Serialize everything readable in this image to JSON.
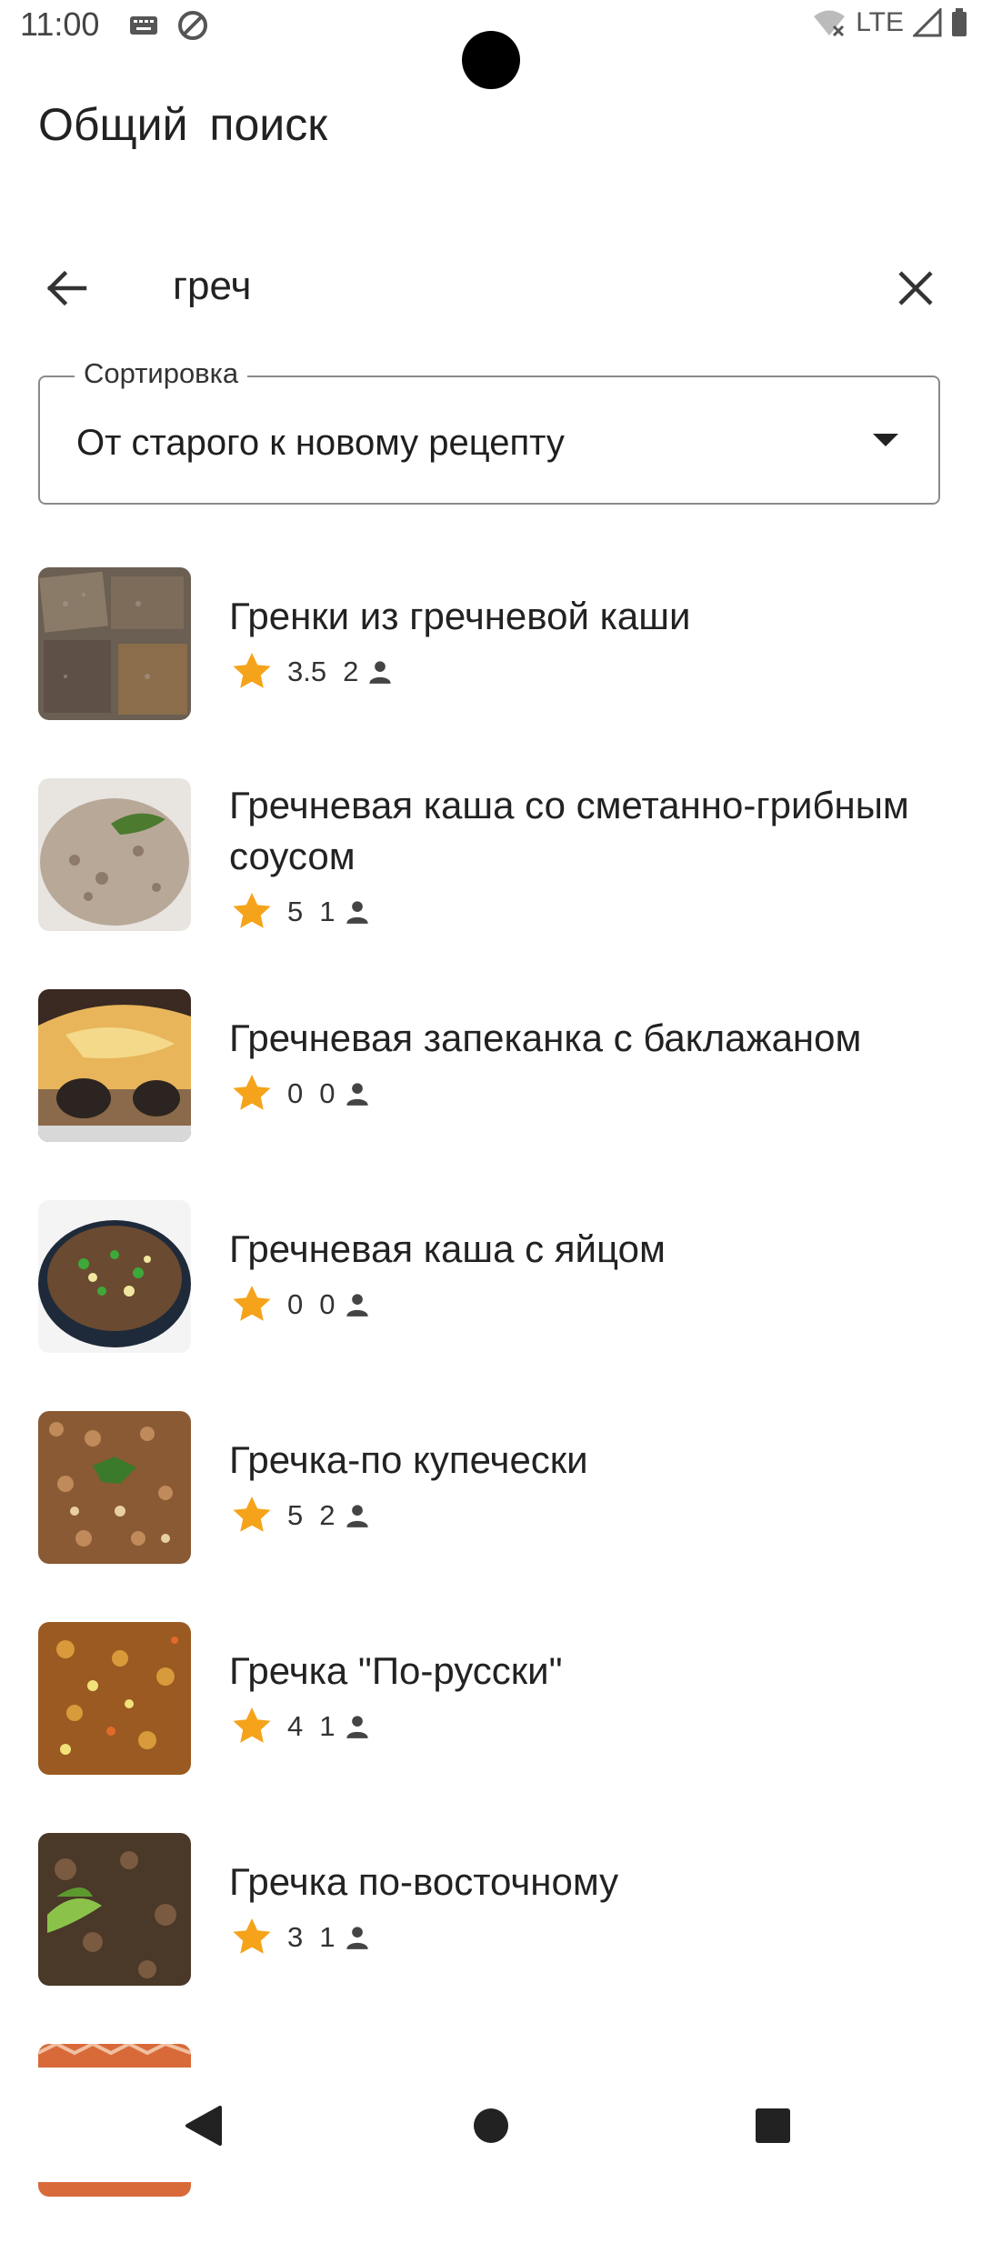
{
  "status": {
    "time": "11:00",
    "network": "LTE"
  },
  "header": {
    "title": "Общий  поиск"
  },
  "search": {
    "query": "греч"
  },
  "sort": {
    "label": "Сортировка",
    "value": "От старого к новому рецепту"
  },
  "colors": {
    "star": "#f5a31a",
    "text": "#222222",
    "outline": "#8a8a8a"
  },
  "icons": {
    "back": "arrow-left-icon",
    "clear": "close-icon",
    "dropdown": "caret-down-icon",
    "rating": "star-icon",
    "users": "person-icon",
    "nav": [
      "back-triangle-icon",
      "home-circle-icon",
      "recents-square-icon"
    ]
  },
  "recipes": [
    {
      "title": "Гренки из гречневой каши",
      "rating": "3.5",
      "count": "2"
    },
    {
      "title": "Гречневая каша со сметанно-грибным соусом",
      "rating": "5",
      "count": "1"
    },
    {
      "title": "Гречневая запеканка с баклажаном",
      "rating": "0",
      "count": "0"
    },
    {
      "title": "Гречневая каша с яйцом",
      "rating": "0",
      "count": "0"
    },
    {
      "title": "Гречка-по купечески",
      "rating": "5",
      "count": "2"
    },
    {
      "title": "Гречка \"По-русски\"",
      "rating": "4",
      "count": "1"
    },
    {
      "title": "Гречка по-восточному",
      "rating": "3",
      "count": "1"
    }
  ]
}
